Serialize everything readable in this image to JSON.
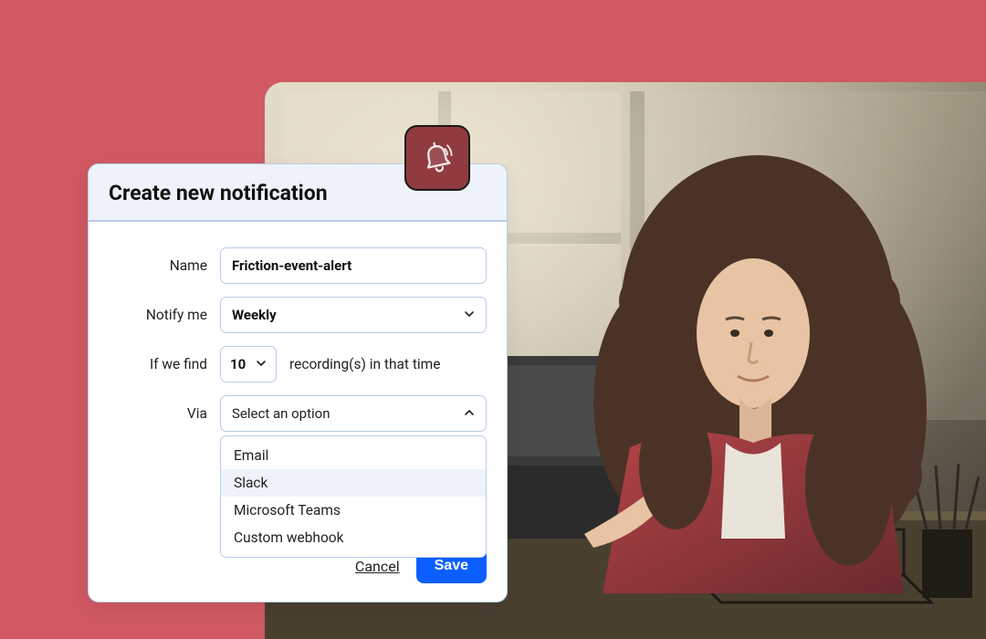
{
  "colors": {
    "page_bg": "#d05963",
    "badge_bg": "#8f3b40",
    "primary": "#0b5fff",
    "border": "#b9cbe8",
    "header_bg": "#eef3fb"
  },
  "badge": {
    "icon": "bell-icon"
  },
  "modal": {
    "title": "Create new notification",
    "fields": {
      "name": {
        "label": "Name",
        "value": "Friction-event-alert"
      },
      "notify_me": {
        "label": "Notify me",
        "value": "Weekly"
      },
      "threshold": {
        "label": "If we find",
        "count": "10",
        "suffix": "recording(s) in that time"
      },
      "via": {
        "label": "Via",
        "placeholder": "Select an option",
        "options": [
          "Email",
          "Slack",
          "Microsoft Teams",
          "Custom webhook"
        ],
        "highlighted_index": 1
      }
    },
    "footer": {
      "cancel": "Cancel",
      "save": "Save"
    }
  }
}
